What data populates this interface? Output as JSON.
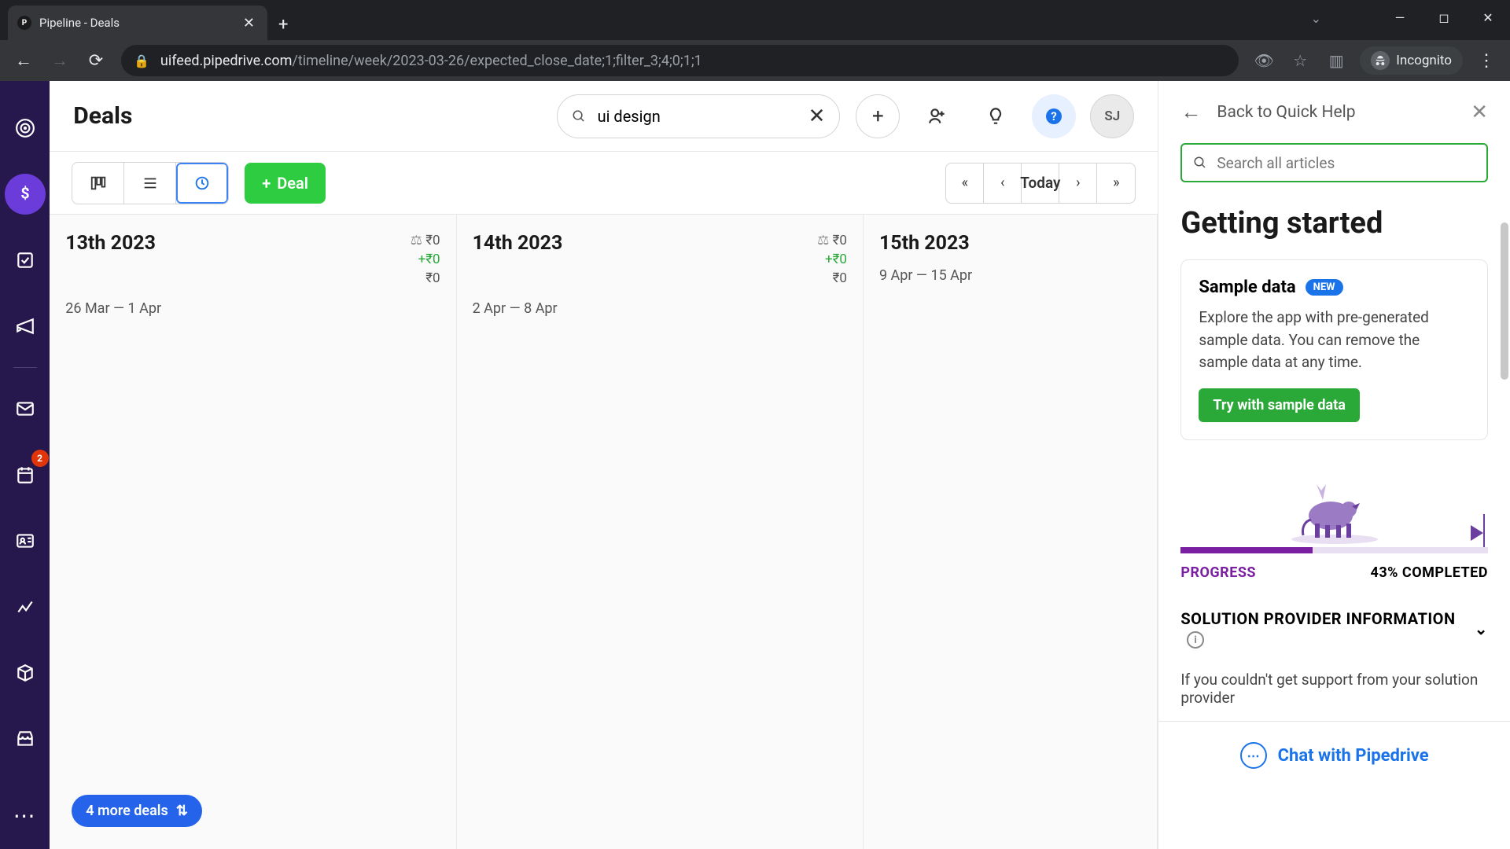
{
  "browser": {
    "tab_title": "Pipeline - Deals",
    "url_host": "uifeed.pipedrive.com",
    "url_path": "/timeline/week/2023-03-26/expected_close_date;1;filter_3;4;0;1;1",
    "incognito_label": "Incognito"
  },
  "sidebar": {
    "notification_count": "2"
  },
  "header": {
    "title": "Deals",
    "search_value": "ui design",
    "avatar_initials": "SJ"
  },
  "subheader": {
    "deal_button": "Deal",
    "today_label": "Today"
  },
  "columns": [
    {
      "title": "13th 2023",
      "val": "₹0",
      "plus": "+₹0",
      "zero": "₹0",
      "range": "26 Mar — 1 Apr",
      "scale_icon": true
    },
    {
      "title": "14th 2023",
      "val": "₹0",
      "plus": "+₹0",
      "zero": "₹0",
      "range": "2 Apr — 8 Apr",
      "scale_icon": true
    },
    {
      "title": "15th 2023",
      "val": "",
      "plus": "",
      "zero": "",
      "range": "9 Apr — 15 Apr",
      "scale_icon": false
    }
  ],
  "more_pill": "4 more deals",
  "help": {
    "back_label": "Back to Quick Help",
    "search_placeholder": "Search all articles",
    "title": "Getting started",
    "card_title": "Sample data",
    "new_badge": "NEW",
    "card_desc": "Explore the app with pre-generated sample data. You can remove the sample data at any time.",
    "card_button": "Try with sample data",
    "progress_label": "PROGRESS",
    "progress_value": "43% COMPLETED",
    "accordion_title": "SOLUTION PROVIDER INFORMATION",
    "note": "If you couldn't get support from your solution provider",
    "chat_label": "Chat with Pipedrive"
  }
}
